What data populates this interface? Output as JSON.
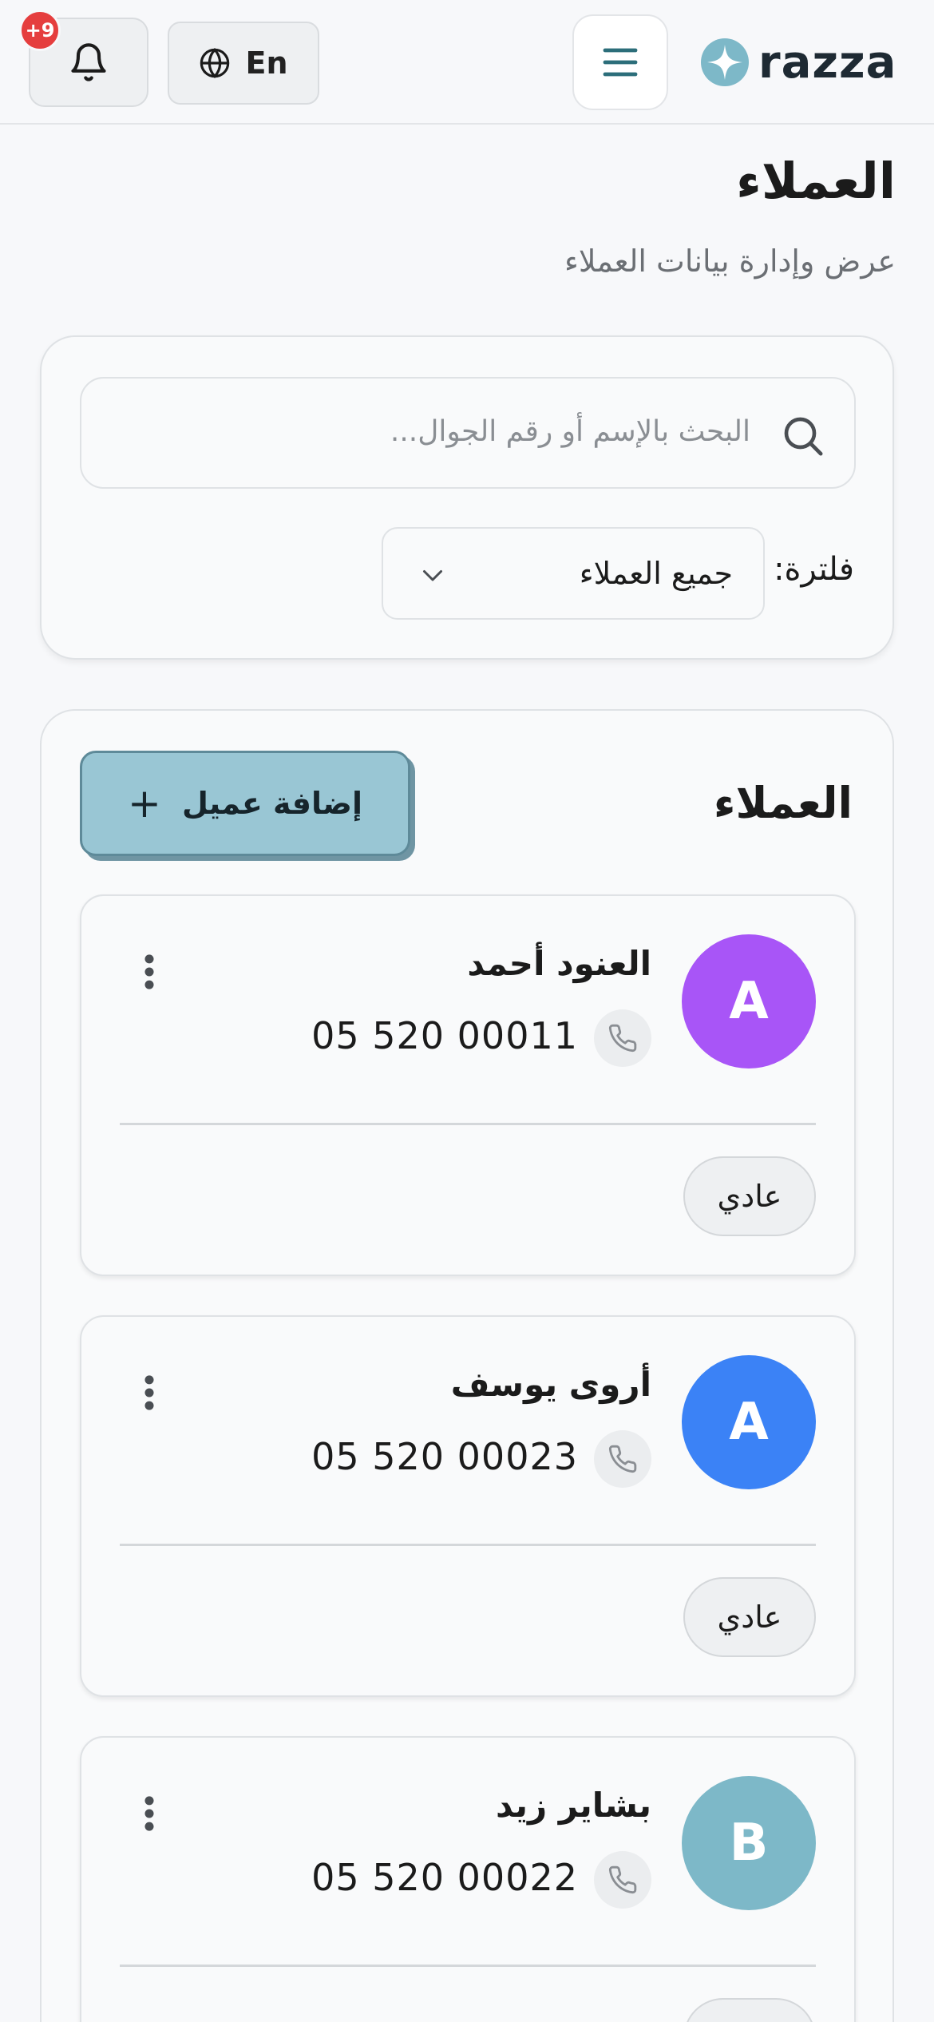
{
  "header": {
    "notification_count": "+9",
    "language_label": "En",
    "brand_name": "razza"
  },
  "page": {
    "title": "العملاء",
    "subtitle": "عرض وإدارة بيانات العملاء"
  },
  "filters": {
    "search_placeholder": "البحث بالإسم أو رقم الجوال...",
    "filter_label": "فلترة:",
    "filter_value": "جميع العملاء"
  },
  "customers": {
    "title": "العملاء",
    "add_button_label": "إضافة عميل",
    "items": [
      {
        "initial": "A",
        "name": "العنود أحمد",
        "phone": "05 520 00011",
        "type": "عادي",
        "avatar_color": "#a855f7"
      },
      {
        "initial": "A",
        "name": "أروى يوسف",
        "phone": "05 520 00023",
        "type": "عادي",
        "avatar_color": "#3b82f6"
      },
      {
        "initial": "B",
        "name": "بشاير زيد",
        "phone": "05 520 00022",
        "type": "عادي",
        "avatar_color": "#7db8c8"
      }
    ]
  },
  "icons": [
    "bell-icon",
    "globe-icon",
    "hamburger-menu-icon",
    "brand-logo-icon",
    "search-icon",
    "chevron-down-icon",
    "plus-icon",
    "phone-icon",
    "more-vertical-icon"
  ],
  "colors": {
    "accent": "#99c6d4",
    "badge": "#e53e3e",
    "brand": "#1e2a33"
  }
}
